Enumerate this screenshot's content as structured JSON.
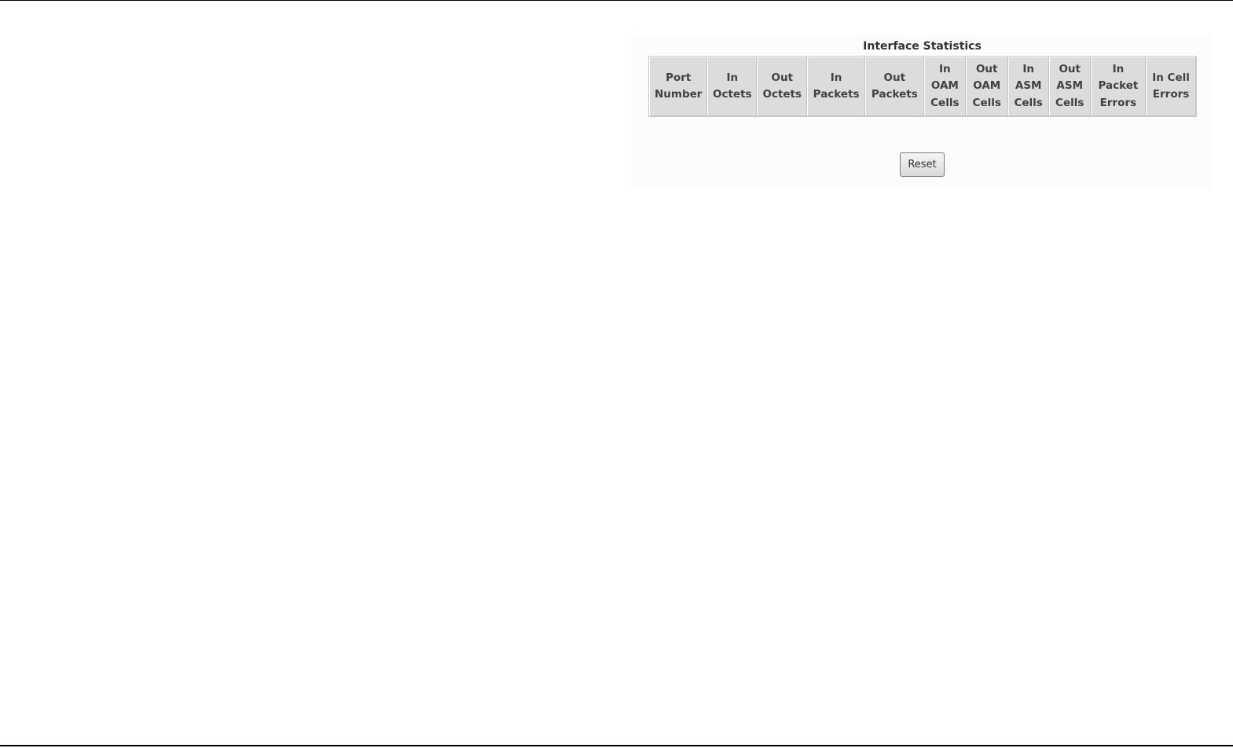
{
  "statistics": {
    "title": "Interface Statistics",
    "columns": [
      [
        "Port",
        "Number"
      ],
      [
        "In",
        "Octets"
      ],
      [
        "Out",
        "Octets"
      ],
      [
        "In",
        "Packets"
      ],
      [
        "Out",
        "Packets"
      ],
      [
        "In",
        "OAM",
        "Cells"
      ],
      [
        "Out",
        "OAM",
        "Cells"
      ],
      [
        "In",
        "ASM",
        "Cells"
      ],
      [
        "Out",
        "ASM",
        "Cells"
      ],
      [
        "In",
        "Packet",
        "Errors"
      ],
      [
        "In Cell",
        "Errors"
      ]
    ]
  },
  "actions": {
    "reset_label": "Reset"
  }
}
